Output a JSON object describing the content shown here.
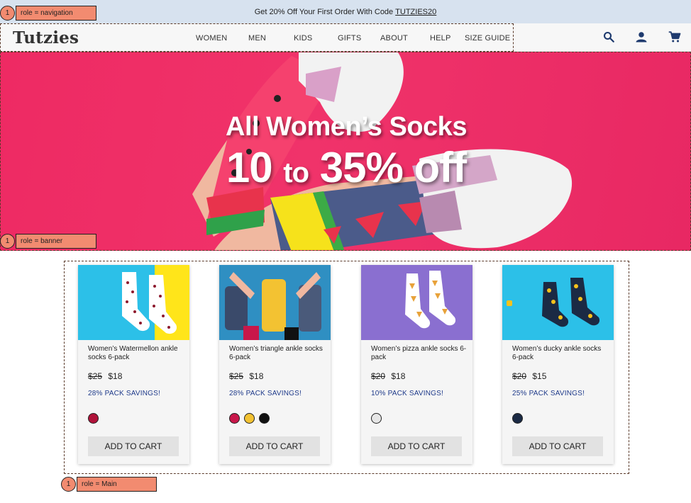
{
  "promo": {
    "text": "Get 20% Off Your First Order With Code",
    "code": "TUTZIES20"
  },
  "header": {
    "logo": "Tutzies",
    "nav": [
      "WOMEN",
      "MEN",
      "KIDS",
      "GIFTS",
      "ABOUT",
      "HELP",
      "SIZE GUIDE"
    ],
    "icons": [
      "search-icon",
      "account-icon",
      "cart-icon"
    ]
  },
  "hero": {
    "title": "All Women’s Socks",
    "sub_a": "10",
    "sub_to": "to",
    "sub_b": "35% off"
  },
  "landmarks": {
    "navigation": {
      "num": "1",
      "label": "role = navigation"
    },
    "banner": {
      "num": "1",
      "label": "role = banner"
    },
    "main": {
      "num": "1",
      "label": "role = Main"
    }
  },
  "products": [
    {
      "name": "Women’s Watermellon ankle socks 6-pack",
      "old_price": "$25",
      "price": "$18",
      "savings": "28% PACK SAVINGS!",
      "swatches": [
        "#b0133a"
      ],
      "button": "ADD TO CART"
    },
    {
      "name": "Women’s triangle ankle socks 6-pack",
      "old_price": "$25",
      "price": "$18",
      "savings": "28% PACK SAVINGS!",
      "swatches": [
        "#c8174a",
        "#f3c232",
        "#111111"
      ],
      "button": "ADD TO CART"
    },
    {
      "name": "Women’s pizza ankle socks 6-pack",
      "old_price": "$20",
      "price": "$18",
      "savings": "10% PACK SAVINGS!",
      "swatches": [
        "#e6e6e6"
      ],
      "button": "ADD TO CART"
    },
    {
      "name": "Women’s ducky ankle socks 6-pack",
      "old_price": "$20",
      "price": "$15",
      "savings": "25% PACK SAVINGS!",
      "swatches": [
        "#1b2a44"
      ],
      "button": "ADD TO CART"
    }
  ],
  "colors": {
    "promo_bg": "#d7e2ef",
    "hero_bg": "#ee2a63",
    "savings": "#1e3a8a",
    "tag": "#f28b70"
  }
}
